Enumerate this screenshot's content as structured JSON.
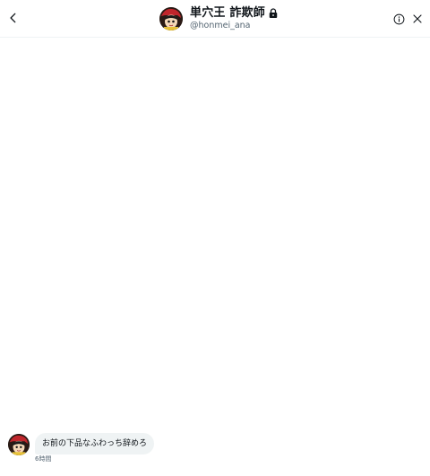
{
  "header": {
    "display_name": "単穴王 詐欺師",
    "handle": "@honmei_ana",
    "back_icon": "chevron-left-icon",
    "info_icon": "info-circle-icon",
    "close_icon": "close-icon",
    "lock_icon": "lock-icon"
  },
  "messages": [
    {
      "text": "お前の下品なふわっち辞めろ",
      "time": "6時間",
      "direction": "received"
    }
  ],
  "colors": {
    "bubble_received": "#eff3f4",
    "secondary_text": "#536471",
    "divider": "#eff3f4"
  }
}
